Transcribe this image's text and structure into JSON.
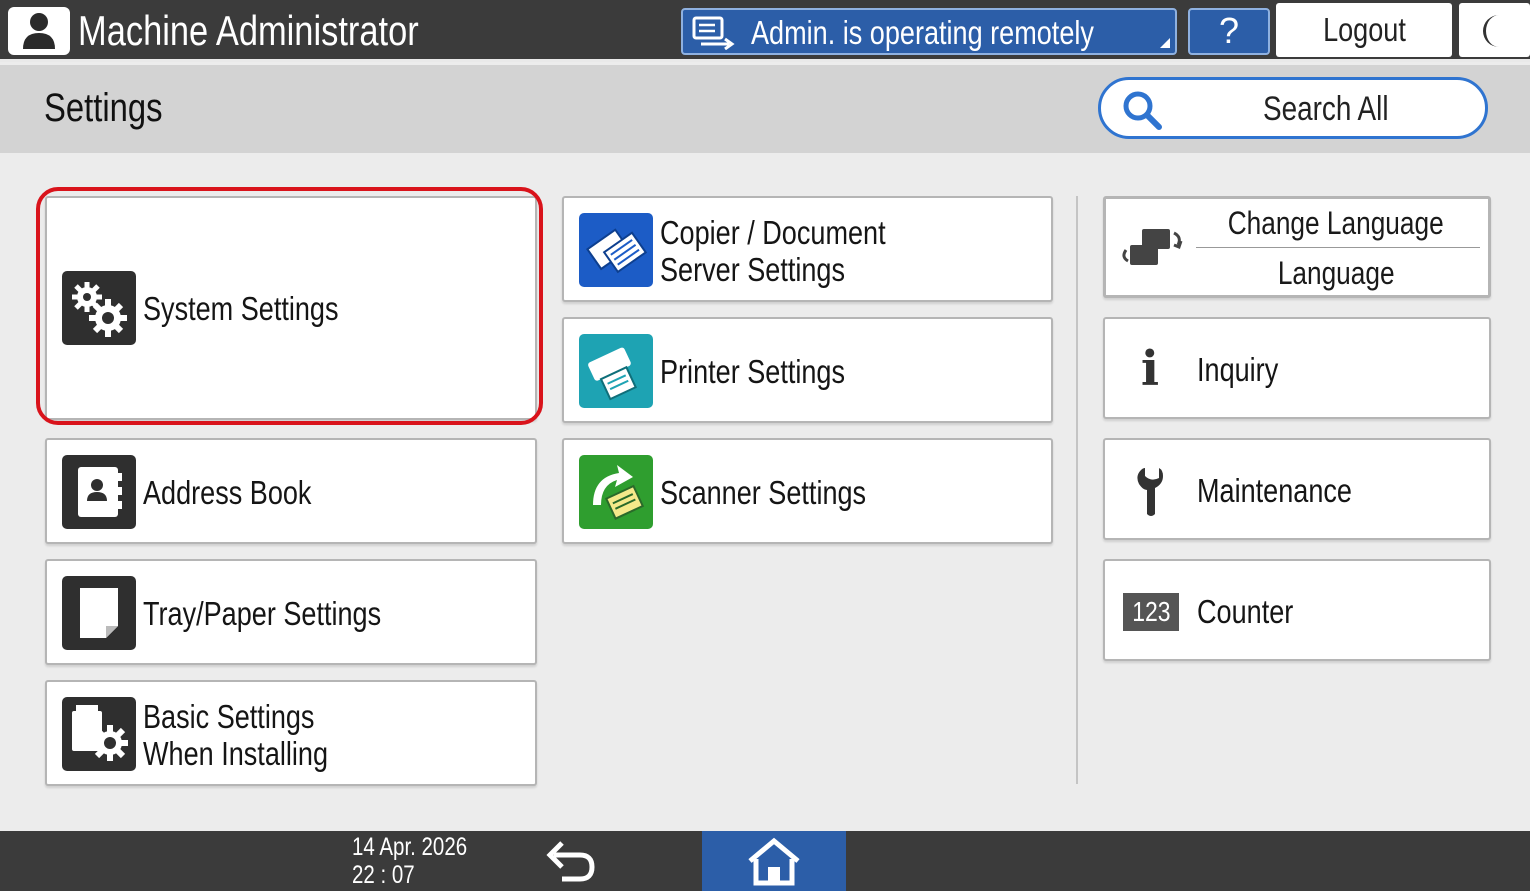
{
  "topbar": {
    "user_title": "Machine Administrator",
    "remote_status": "Admin. is operating remotely",
    "help_label": "?",
    "logout_label": "Logout"
  },
  "header": {
    "title": "Settings",
    "search_label": "Search All"
  },
  "left_tiles": [
    {
      "label": "System Settings",
      "icon": "gears-icon"
    },
    {
      "label": "Address Book",
      "icon": "address-book-icon"
    },
    {
      "label": "Tray/Paper Settings",
      "icon": "paper-icon"
    },
    {
      "label_lines": [
        "Basic Settings",
        "When Installing"
      ],
      "icon": "install-settings-icon"
    }
  ],
  "middle_tiles": [
    {
      "label_lines": [
        "Copier / Document",
        "Server Settings"
      ],
      "icon": "copier-icon"
    },
    {
      "label": "Printer Settings",
      "icon": "printer-icon"
    },
    {
      "label": "Scanner Settings",
      "icon": "scanner-icon"
    }
  ],
  "right_tiles": {
    "language": {
      "title": "Change Language",
      "value": "Language",
      "icon": "change-language-icon"
    },
    "inquiry": {
      "label": "Inquiry",
      "icon": "info-icon"
    },
    "maintenance": {
      "label": "Maintenance",
      "icon": "wrench-icon"
    },
    "counter": {
      "label": "Counter",
      "icon_text": "123"
    }
  },
  "bottombar": {
    "date": "14 Apr. 2026",
    "time": "22 : 07"
  },
  "colors": {
    "accent_blue": "#2c5ea8",
    "highlight_red": "#d9131b",
    "bar_dark": "#3b3b3b"
  }
}
